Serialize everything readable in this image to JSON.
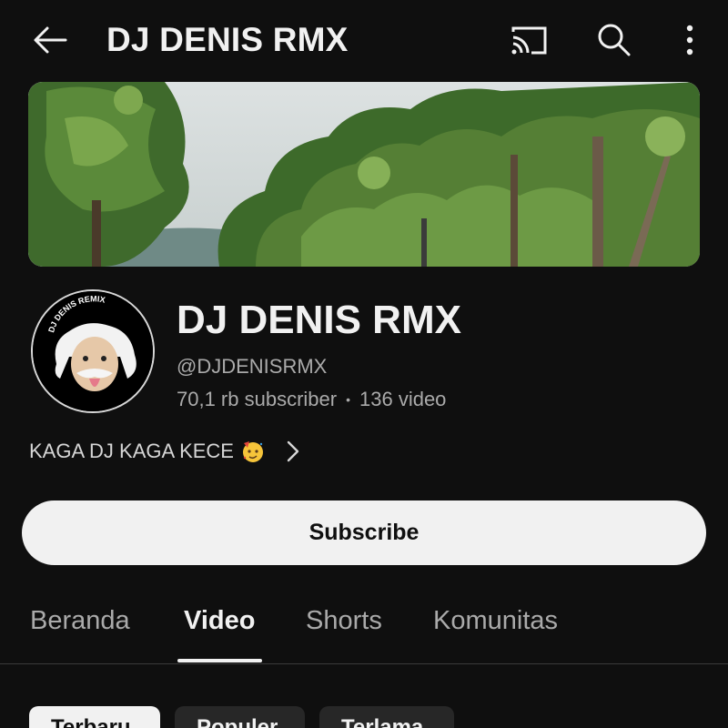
{
  "header": {
    "title": "DJ DENIS RMX",
    "back_icon": "back-arrow-icon",
    "cast_icon": "cast-icon",
    "search_icon": "search-icon",
    "more_icon": "more-vertical-icon"
  },
  "channel": {
    "name": "DJ DENIS RMX",
    "handle": "@DJDENISRMX",
    "subscribers": "70,1 rb subscriber",
    "separator": "•",
    "videos": "136 video",
    "description": "KAGA DJ KAGA KECE",
    "description_emoji": "partying-face-emoji",
    "avatar_logo_text": "DJ DENIS REMIX"
  },
  "subscribe": {
    "label": "Subscribe"
  },
  "tabs": [
    {
      "label": "Beranda",
      "active": false
    },
    {
      "label": "Video",
      "active": true
    },
    {
      "label": "Shorts",
      "active": false
    },
    {
      "label": "Komunitas",
      "active": false
    }
  ],
  "filter_chips": [
    {
      "label": "Terbaru",
      "selected": true
    },
    {
      "label": "Populer",
      "selected": false
    },
    {
      "label": "Terlama",
      "selected": false
    }
  ],
  "colors": {
    "background": "#0f0f0f",
    "text_primary": "#f1f1f1",
    "text_secondary": "#aaaaaa",
    "subscribe_bg": "#f1f1f1",
    "chip_unselected_bg": "#272727"
  }
}
